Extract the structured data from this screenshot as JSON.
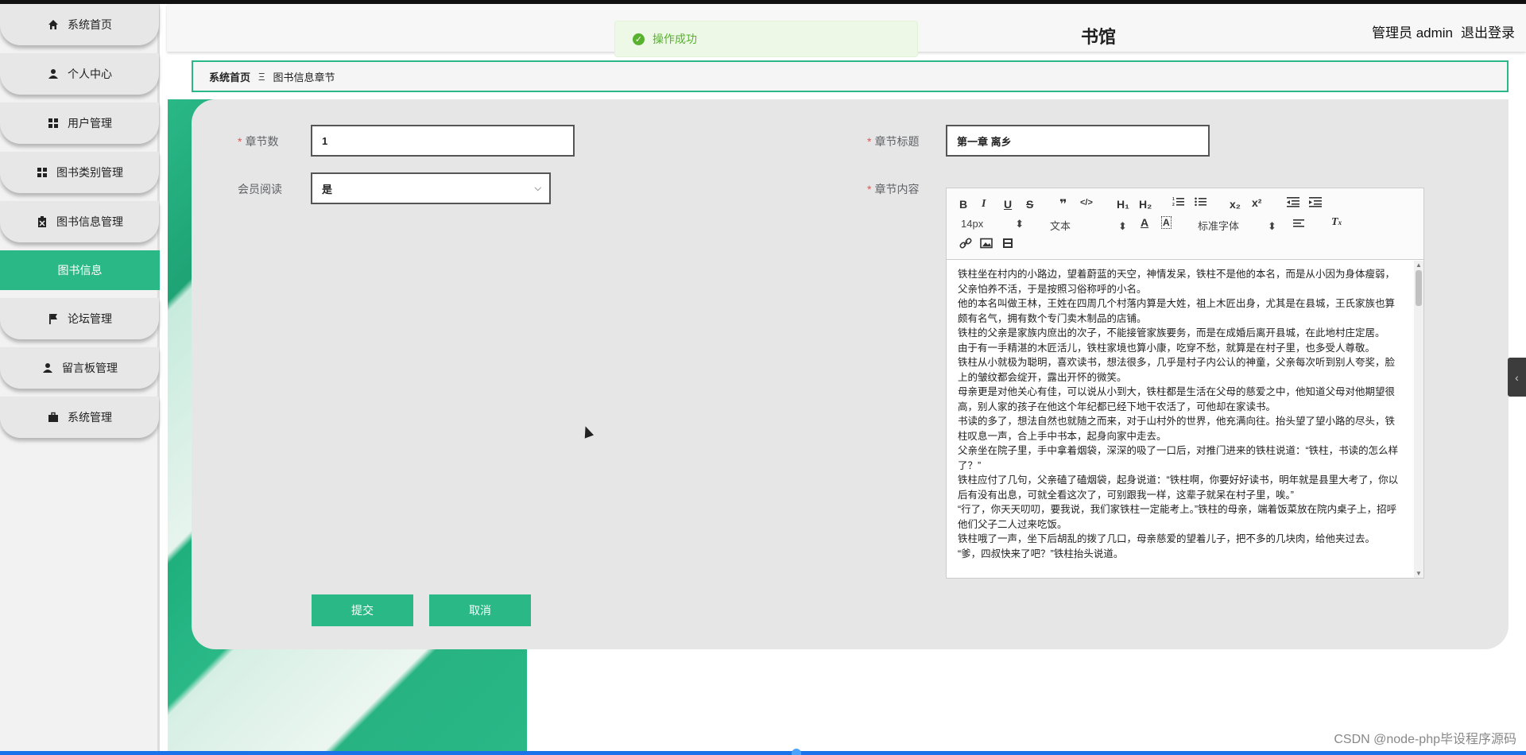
{
  "header": {
    "title_fragment": "书馆",
    "user_label": "管理员 admin",
    "logout_label": "退出登录"
  },
  "toast": {
    "message": "操作成功",
    "status_color": "#58b12f"
  },
  "sidebar": {
    "items": [
      {
        "label": "系统首页",
        "icon": "home-icon"
      },
      {
        "label": "个人中心",
        "icon": "user-icon"
      },
      {
        "label": "用户管理",
        "icon": "grid-icon"
      },
      {
        "label": "图书类别管理",
        "icon": "grid-icon"
      },
      {
        "label": "图书信息管理",
        "icon": "clipboard-icon"
      },
      {
        "label": "论坛管理",
        "icon": "flag-icon"
      },
      {
        "label": "留言板管理",
        "icon": "user-icon"
      },
      {
        "label": "系统管理",
        "icon": "briefcase-icon"
      }
    ],
    "active_sub": "图书信息",
    "accent_color": "#2ab887"
  },
  "breadcrumb": {
    "home": "系统首页",
    "separator": "Ξ",
    "current": "图书信息章节"
  },
  "form": {
    "chapter_number": {
      "label": "章节数",
      "value": "1"
    },
    "chapter_title": {
      "label": "章节标题",
      "value": "第一章 离乡"
    },
    "member_read": {
      "label": "会员阅读",
      "value": "是"
    },
    "chapter_content": {
      "label": "章节内容"
    }
  },
  "editor": {
    "toolbar": {
      "bold": "B",
      "italic": "I",
      "underline": "U",
      "strike": "S",
      "quote": "❞",
      "code": "</>",
      "h1": "H₁",
      "h2": "H₂",
      "subscript": "x₂",
      "superscript": "x²",
      "font_size": "14px",
      "text_type": "文本",
      "font_family": "标准字体"
    },
    "paragraphs": [
      "铁柱坐在村内的小路边，望着蔚蓝的天空，神情发呆，铁柱不是他的本名，而是从小因为身体瘦弱，父亲怕养不活，于是按照习俗称呼的小名。",
      "他的本名叫做王林，王姓在四周几个村落内算是大姓，祖上木匠出身，尤其是在县城，王氏家族也算颇有名气，拥有数个专门卖木制品的店铺。",
      "铁柱的父亲是家族内庶出的次子，不能接管家族要务，而是在成婚后离开县城，在此地村庄定居。",
      "由于有一手精湛的木匠活儿，铁柱家境也算小康，吃穿不愁，就算是在村子里，也多受人尊敬。",
      "铁柱从小就极为聪明，喜欢读书，想法很多，几乎是村子内公认的神童，父亲每次听到别人夸奖，脸上的皱纹都会绽开，露出开怀的微笑。",
      "母亲更是对他关心有佳，可以说从小到大，铁柱都是生活在父母的慈爱之中，他知道父母对他期望很高，别人家的孩子在他这个年纪都已经下地干农活了，可他却在家读书。",
      "书读的多了，想法自然也就随之而来，对于山村外的世界，他充满向往。抬头望了望小路的尽头，铁柱叹息一声，合上手中书本，起身向家中走去。",
      "父亲坐在院子里，手中拿着烟袋，深深的吸了一口后，对推门进来的铁柱说道：“铁柱，书读的怎么样了？”",
      "铁柱应付了几句，父亲磕了磕烟袋，起身说道：“铁柱啊，你要好好读书，明年就是县里大考了，你以后有没有出息，可就全看这次了，可别跟我一样，这辈子就呆在村子里，唉。”",
      "“行了，你天天叨叨，要我说，我们家铁柱一定能考上。”铁柱的母亲，端着饭菜放在院内桌子上，招呼他们父子二人过来吃饭。",
      "铁柱哦了一声，坐下后胡乱的拨了几口，母亲慈爱的望着儿子，把不多的几块肉，给他夹过去。",
      "“爹，四叔快来了吧？”铁柱抬头说道。"
    ]
  },
  "buttons": {
    "submit": "提交",
    "cancel": "取消"
  },
  "side_tab": "‹",
  "watermark": "CSDN @node-php毕设程序源码"
}
